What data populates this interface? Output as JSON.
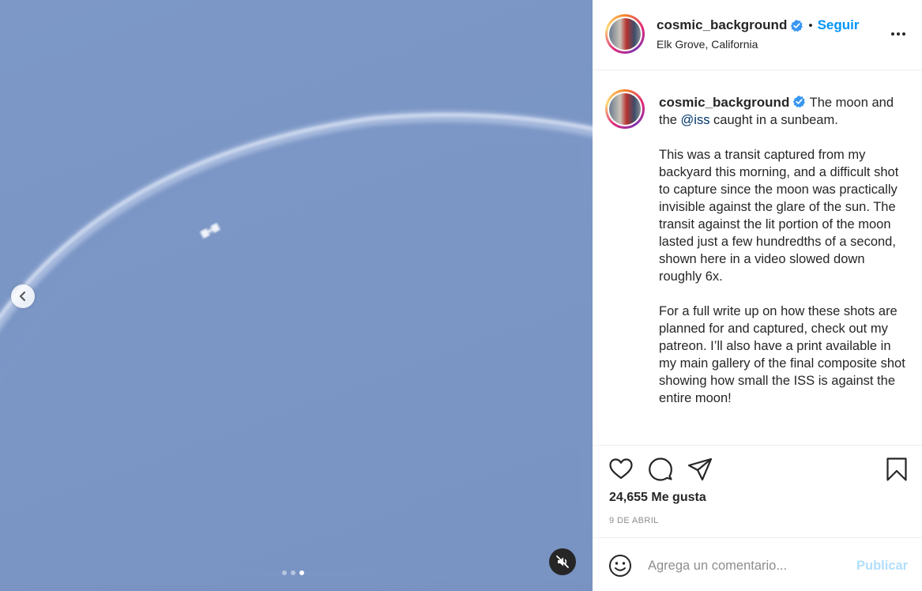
{
  "post": {
    "username": "cosmic_background",
    "location": "Elk Grove, California",
    "follow_label": "Seguir",
    "bullet": "•",
    "caption_lead": "The moon and the ",
    "caption_mention": "@iss",
    "caption_tail": " caught in a sunbeam.",
    "caption_p2": "This was a transit captured from my backyard this morning, and a difficult shot to capture since the moon was practically invisible against the glare of the sun. The transit against the lit portion of the moon lasted just a few hundredths of a second, shown here in a video slowed down roughly 6x.",
    "caption_p3": "For a full write up on how these shots are planned for and captured, check out my patreon. I’ll also have a print available in my main gallery of the final composite shot showing how small the ISS is against the entire moon!",
    "likes": "24,655 Me gusta",
    "date": "9 DE ABRIL"
  },
  "comment": {
    "placeholder": "Agrega un comentario...",
    "publish_label": "Publicar"
  },
  "carousel": {
    "total": 3,
    "active_index": 2
  },
  "icons": {
    "verified": "verified-badge-icon",
    "more": "more-options-icon",
    "like": "heart-icon",
    "comment": "comment-bubble-icon",
    "share": "paper-plane-icon",
    "save": "bookmark-icon",
    "emoji": "emoji-smile-icon",
    "mute": "speaker-muted-icon",
    "prev": "chevron-left-icon"
  },
  "colors": {
    "accent": "#0095f6",
    "publish_disabled": "#b2dffc",
    "verified": "#3897f0",
    "sky": "#7a95c4"
  }
}
